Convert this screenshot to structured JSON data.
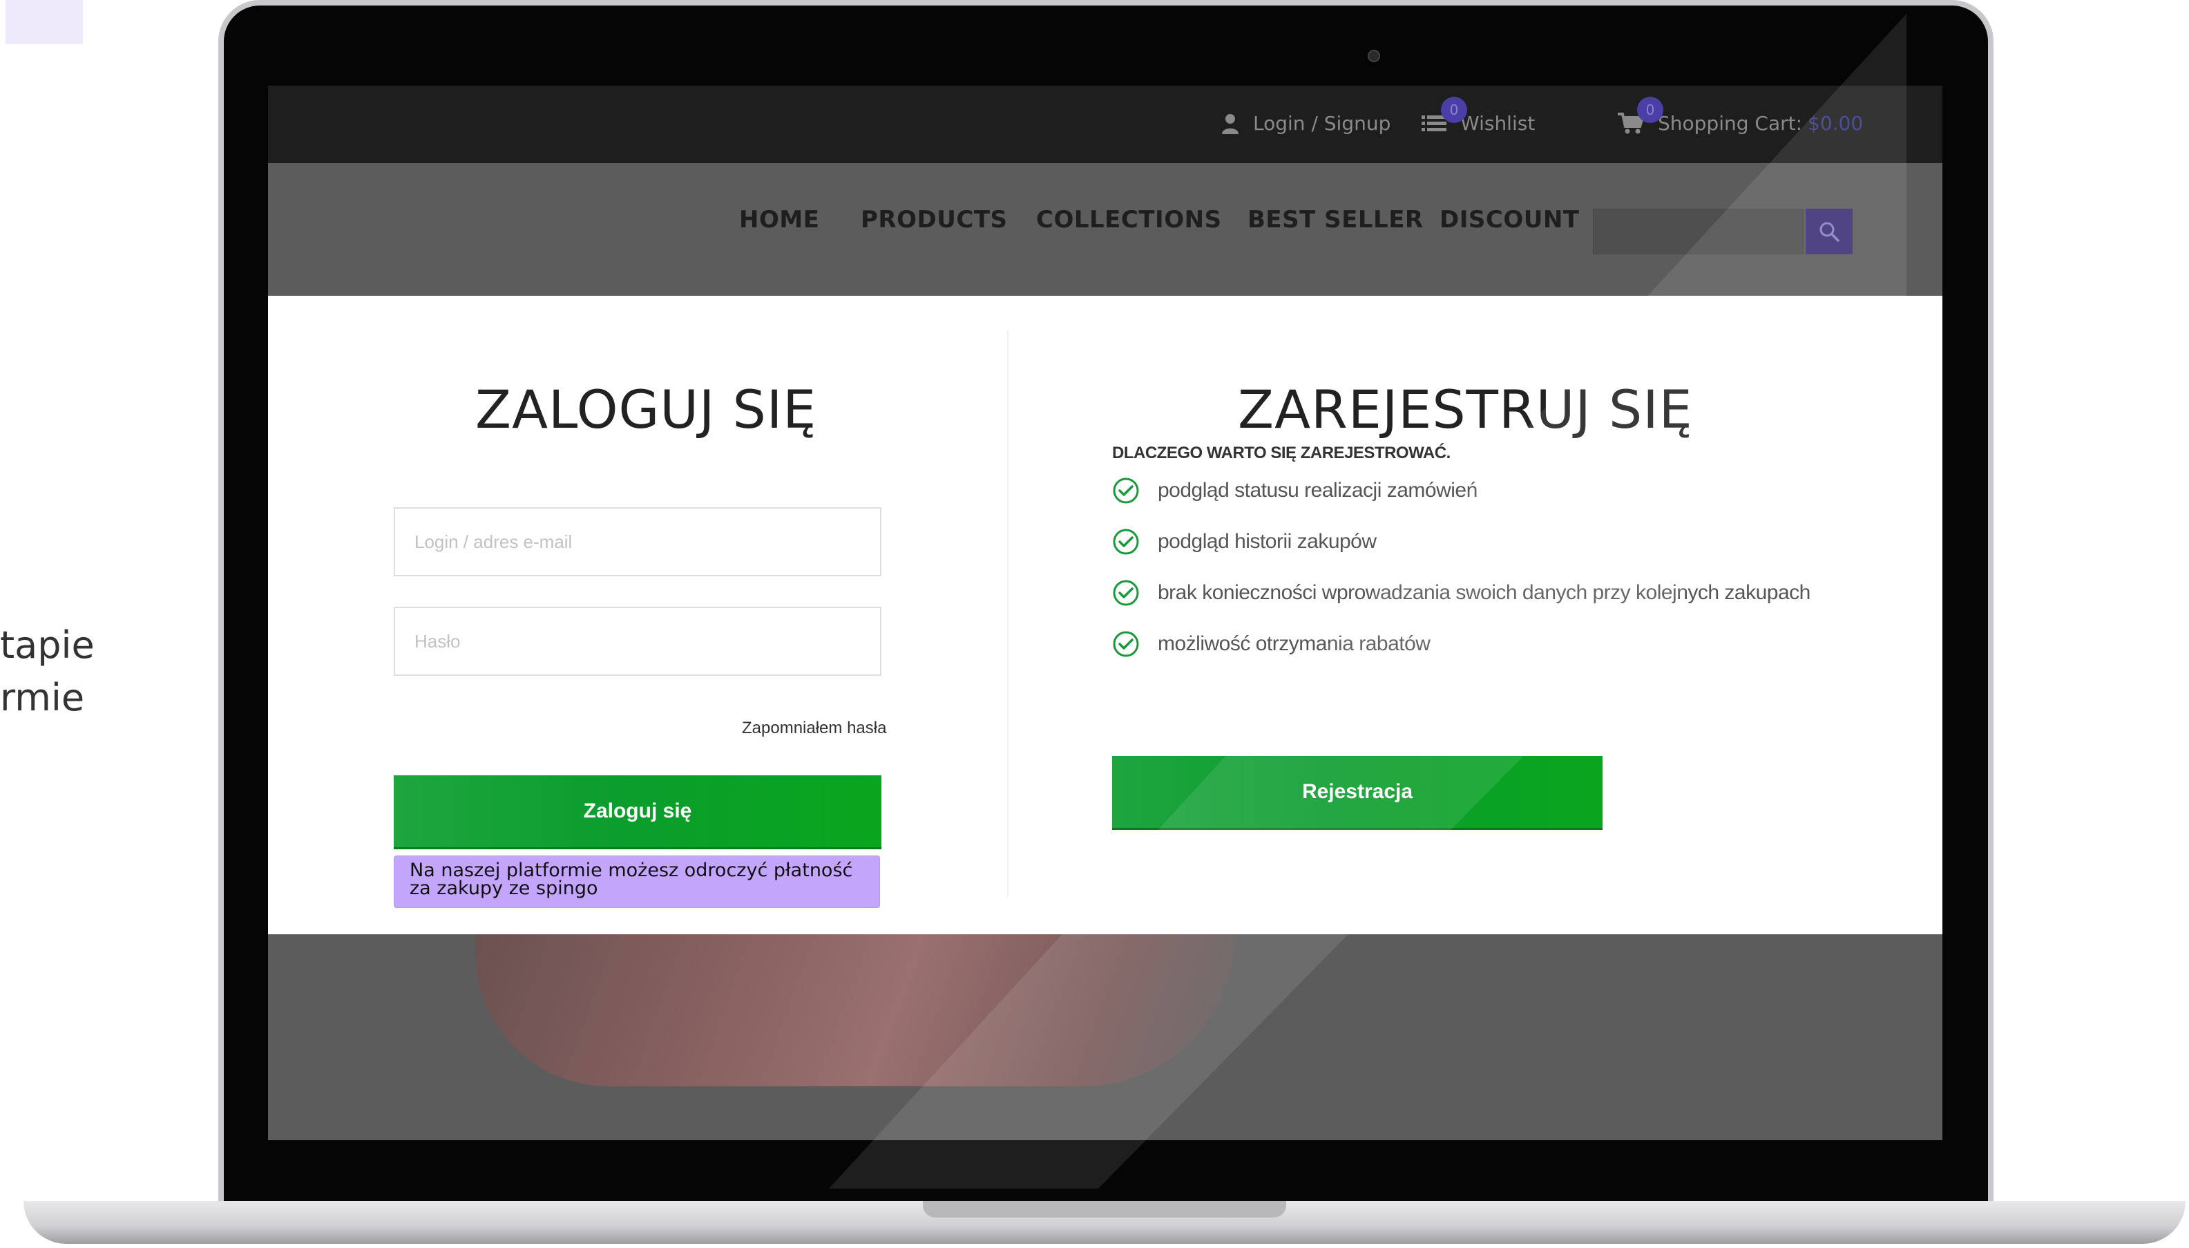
{
  "side_text": [
    "tapie",
    "rmie"
  ],
  "topbar": {
    "login_signup": "Login / Signup",
    "wishlist": {
      "label": "Wishlist",
      "count": "0"
    },
    "cart": {
      "label": "Shopping Cart:",
      "price": "$0.00",
      "count": "0"
    }
  },
  "nav": {
    "items": [
      "HOME",
      "PRODUCTS",
      "COLLECTIONS",
      "BEST SELLER",
      "DISCOUNT"
    ],
    "search_placeholder": ""
  },
  "login": {
    "heading": "ZALOGUJ SIĘ",
    "login_placeholder": "Login / adres e-mail",
    "password_placeholder": "Hasło",
    "forgot_password": "Zapomniałem hasła",
    "button": "Zaloguj się",
    "note": "Na naszej platformie możesz odroczyć płatność za zakupy ze spingo"
  },
  "register": {
    "heading": "ZAREJESTRUJ SIĘ",
    "why_title": "DLACZEGO WARTO SIĘ ZAREJESTROWAĆ.",
    "benefits": [
      "podgląd statusu realizacji zamówień",
      "podgląd historii zakupów",
      "brak konieczności wprowadzania swoich danych przy kolejnych zakupach",
      "możliwość otrzymania rabatów"
    ],
    "button": "Rejestracja"
  },
  "colors": {
    "accent_green": "#0aa51e",
    "promo_purple": "#c3a6fc",
    "nav_search_button": "#3d2f78"
  },
  "icons": [
    "user-icon",
    "wishlist-icon",
    "cart-icon",
    "search-icon",
    "check-circle-icon"
  ]
}
